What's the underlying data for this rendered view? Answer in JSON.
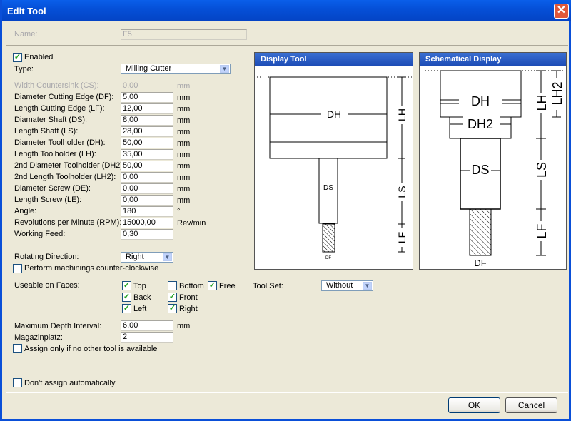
{
  "window": {
    "title": "Edit Tool",
    "close_icon": "close-icon"
  },
  "name": {
    "label": "Name:",
    "value": "F5"
  },
  "enabled": {
    "label": "Enabled",
    "checked": true
  },
  "type": {
    "label": "Type:",
    "value": "Milling Cutter"
  },
  "fields": [
    {
      "label": "Width Countersink (CS):",
      "value": "0,00",
      "unit": "mm",
      "disabled": true
    },
    {
      "label": "Diameter Cutting Edge (DF):",
      "value": "5,00",
      "unit": "mm"
    },
    {
      "label": "Length Cutting Edge (LF):",
      "value": "12,00",
      "unit": "mm"
    },
    {
      "label": "Diamater Shaft (DS):",
      "value": "8,00",
      "unit": "mm"
    },
    {
      "label": "Length Shaft (LS):",
      "value": "28,00",
      "unit": "mm"
    },
    {
      "label": "Diameter Toolholder (DH):",
      "value": "50,00",
      "unit": "mm"
    },
    {
      "label": "Length Toolholder (LH):",
      "value": "35,00",
      "unit": "mm"
    },
    {
      "label": "2nd Diameter Toolholder (DH2):",
      "value": "50,00",
      "unit": "mm"
    },
    {
      "label": "2nd Length Toolholder (LH2):",
      "value": "0,00",
      "unit": "mm"
    },
    {
      "label": "Diameter Screw (DE):",
      "value": "0,00",
      "unit": "mm"
    },
    {
      "label": "Length Screw (LE):",
      "value": "0,00",
      "unit": "mm"
    },
    {
      "label": "Angle:",
      "value": "180",
      "unit": "°"
    },
    {
      "label": "Revolutions per Minute (RPM):",
      "value": "15000,00",
      "unit": "Rev/min"
    },
    {
      "label": "Working Feed:",
      "value": "0,30",
      "unit": ""
    }
  ],
  "rotating": {
    "label": "Rotating Direction:",
    "value": "Right"
  },
  "ccw": {
    "label": "Perform machinings counter-clockwise",
    "checked": false
  },
  "faces": {
    "label": "Useable on Faces:",
    "items": [
      {
        "label": "Top",
        "checked": true
      },
      {
        "label": "Back",
        "checked": true
      },
      {
        "label": "Left",
        "checked": true
      },
      {
        "label": "Bottom",
        "checked": false
      },
      {
        "label": "Front",
        "checked": true
      },
      {
        "label": "Right",
        "checked": true
      },
      {
        "label": "Free",
        "checked": true
      }
    ]
  },
  "toolset": {
    "label": "Tool Set:",
    "value": "Without"
  },
  "depth": {
    "label": "Maximum Depth Interval:",
    "value": "6,00",
    "unit": "mm"
  },
  "magazin": {
    "label": "Magazinplatz:",
    "value": "2"
  },
  "assign_only": {
    "label": "Assign only if no other tool is available",
    "checked": false
  },
  "dont_assign": {
    "label": "Don't assign automatically",
    "checked": false
  },
  "display_tool": {
    "title": "Display Tool",
    "labels": {
      "dh": "DH",
      "ds": "DS",
      "df": "DF",
      "lh": "LH",
      "ls": "LS",
      "lf": "LF"
    }
  },
  "schematic": {
    "title": "Schematical Display",
    "labels": {
      "dh": "DH",
      "dh2": "DH2",
      "ds": "DS",
      "df": "DF",
      "lh": "LH",
      "lh2": "LH2",
      "ls": "LS",
      "lf": "LF"
    }
  },
  "buttons": {
    "ok": "OK",
    "cancel": "Cancel"
  }
}
